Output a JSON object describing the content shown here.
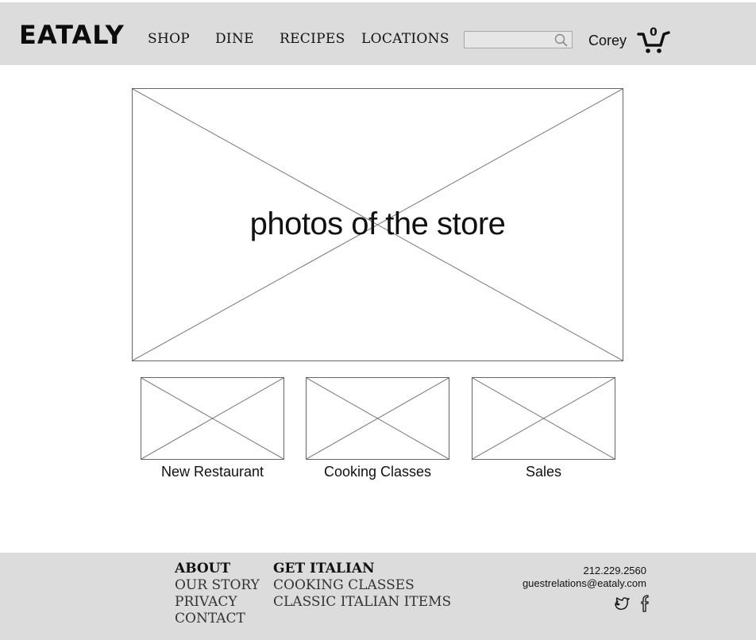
{
  "header": {
    "logo": "EATALY",
    "nav": [
      "SHOP",
      "DINE",
      "RECIPES",
      "LOCATIONS"
    ],
    "search": {
      "value": "",
      "placeholder": ""
    },
    "user": "Corey",
    "cart_count": "0"
  },
  "hero": {
    "label": "photos of the store"
  },
  "features": [
    {
      "caption": "New Restaurant"
    },
    {
      "caption": "Cooking Classes"
    },
    {
      "caption": "Sales"
    }
  ],
  "footer": {
    "about": {
      "heading": "ABOUT",
      "links": [
        "OUR STORY",
        "PRIVACY",
        "CONTACT"
      ]
    },
    "get_italian": {
      "heading": "GET ITALIAN",
      "links": [
        "COOKING CLASSES",
        "CLASSIC ITALIAN ITEMS"
      ]
    },
    "phone": "212.229.2560",
    "email": "guestrelations@eataly.com",
    "social_icons": [
      "twitter-icon",
      "facebook-icon"
    ]
  },
  "colors": {
    "header_bg": "#dcdcdc",
    "footer_bg": "#dcdcdc",
    "text": "#111111"
  }
}
